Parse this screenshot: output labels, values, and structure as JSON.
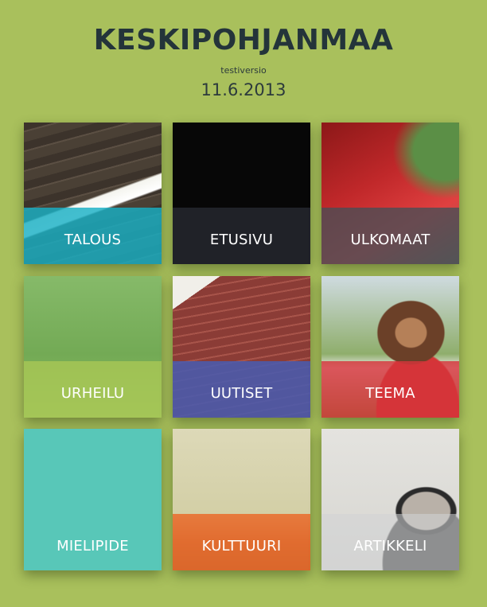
{
  "header": {
    "title": "KESKIPOHJANMAA",
    "subtitle": "testiversio",
    "date": "11.6.2013"
  },
  "colors": {
    "background": "#a9c05c",
    "title_text": "#24343a",
    "talous_band": "#18b0c4",
    "etusivu_band": "#23262c",
    "ulkomaat_band": "#464e56",
    "urheilu_band": "#aac855",
    "uutiset_band": "#465cb2",
    "teema_band": "#d6343a",
    "mielipide_tile": "#58c7b8",
    "kulttuuri_band": "#ea6c2c",
    "artikkeli_band": "#d2d4d6"
  },
  "tiles": [
    {
      "label": "TALOUS",
      "image": "fluorescent-light-ceiling-photo"
    },
    {
      "label": "ETUSIVU",
      "image": "dark-photo"
    },
    {
      "label": "ULKOMAAT",
      "image": "red-awning-trees-photo"
    },
    {
      "label": "URHEILU",
      "image": "grass-field-photo"
    },
    {
      "label": "UUTISET",
      "image": "red-wooden-house-photo"
    },
    {
      "label": "TEEMA",
      "image": "woman-portrait-photo"
    },
    {
      "label": "MIELIPIDE",
      "image": ""
    },
    {
      "label": "KULTTUURI",
      "image": "room-painting-photo"
    },
    {
      "label": "ARTIKKELI",
      "image": "man-portrait-photo"
    }
  ]
}
